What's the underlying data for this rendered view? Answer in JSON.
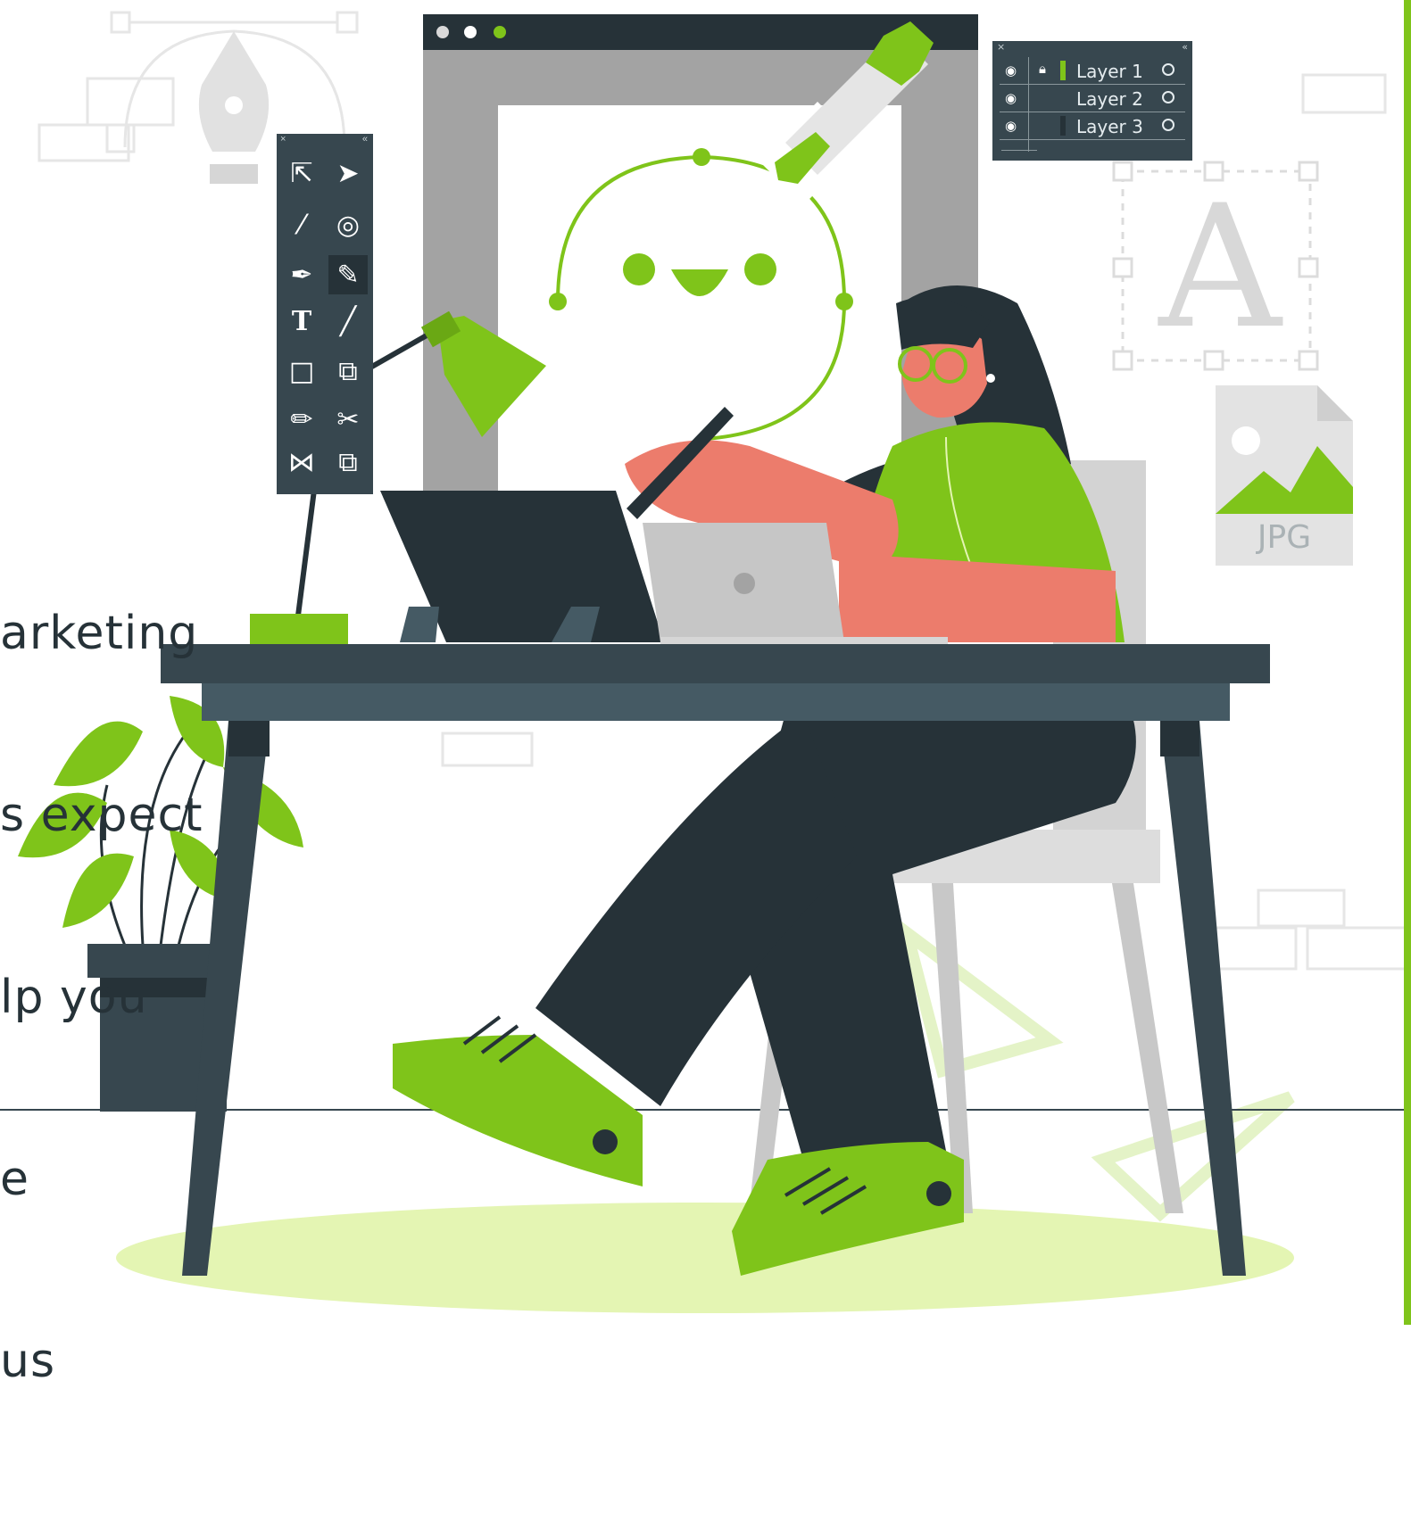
{
  "left_text": {
    "line1": "arketing",
    "line2": "s expect",
    "line3": "lp you",
    "line4": "e",
    "line5": "us"
  },
  "tool_panel": {
    "close": "×",
    "collapse": "«",
    "tools": [
      {
        "name": "selection-tool-icon",
        "glyph": "⇱"
      },
      {
        "name": "direct-selection-tool-icon",
        "glyph": "➤"
      },
      {
        "name": "magic-wand-tool-icon",
        "glyph": "⁄"
      },
      {
        "name": "lasso-tool-icon",
        "glyph": "◎"
      },
      {
        "name": "pen-tool-icon",
        "glyph": "✒"
      },
      {
        "name": "curvature-tool-icon",
        "glyph": "✎"
      },
      {
        "name": "type-tool-icon",
        "glyph": "T"
      },
      {
        "name": "line-tool-icon",
        "glyph": "╱"
      },
      {
        "name": "rectangle-tool-icon",
        "glyph": "□"
      },
      {
        "name": "shaper-tool-icon",
        "glyph": "⧉"
      },
      {
        "name": "pencil-tool-icon",
        "glyph": "✏"
      },
      {
        "name": "scissors-tool-icon",
        "glyph": "✂"
      },
      {
        "name": "reflect-tool-icon",
        "glyph": "⋈"
      },
      {
        "name": "scale-tool-icon",
        "glyph": "⧉"
      }
    ]
  },
  "layers_panel": {
    "close": "×",
    "collapse": "«",
    "layers": [
      {
        "name": "Layer 1",
        "color": "#7fc41a",
        "locked": true
      },
      {
        "name": "Layer 2",
        "color": "#37474f",
        "locked": false
      },
      {
        "name": "Layer 3",
        "color": "#263238",
        "locked": false
      }
    ]
  },
  "file_icon": {
    "label": "JPG"
  },
  "type_icon": {
    "letter": "A"
  },
  "colors": {
    "accent": "#7fc41a",
    "dark": "#263238",
    "slate": "#37474f",
    "skin": "#ec7c6c",
    "light_gray": "#d8d8d8",
    "floor": "#e4f5b3"
  }
}
